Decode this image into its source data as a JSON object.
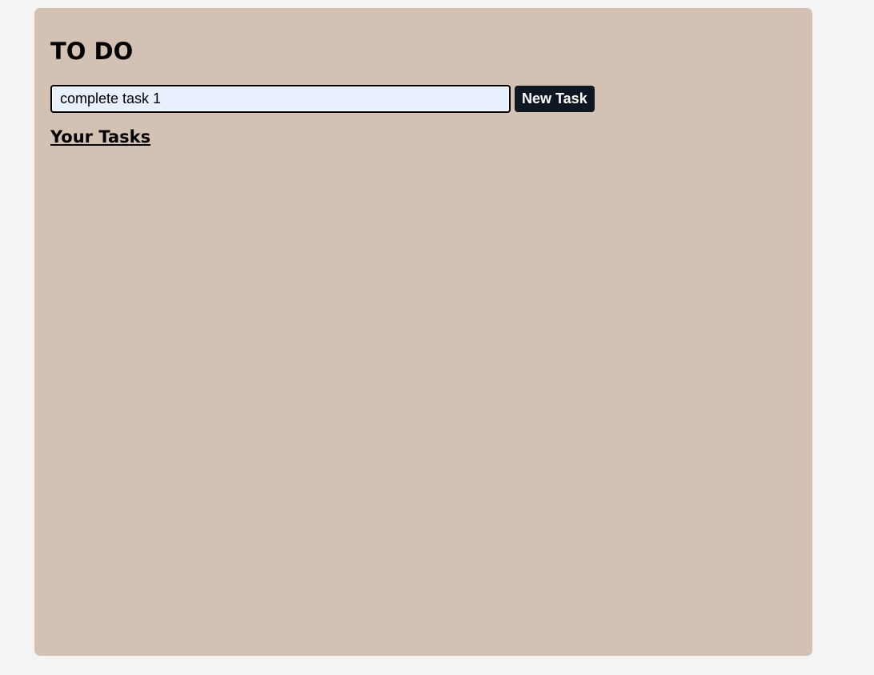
{
  "app": {
    "title": "TO DO"
  },
  "task_form": {
    "input_value": "complete task 1",
    "button_label": "New Task"
  },
  "tasks_section": {
    "heading": "Your Tasks",
    "items": []
  },
  "colors": {
    "page_background": "#f4f4f4",
    "card_background": "#d3c1b3",
    "input_background": "#e8f0fe",
    "button_background": "#0f1722",
    "button_text": "#ffffff"
  }
}
